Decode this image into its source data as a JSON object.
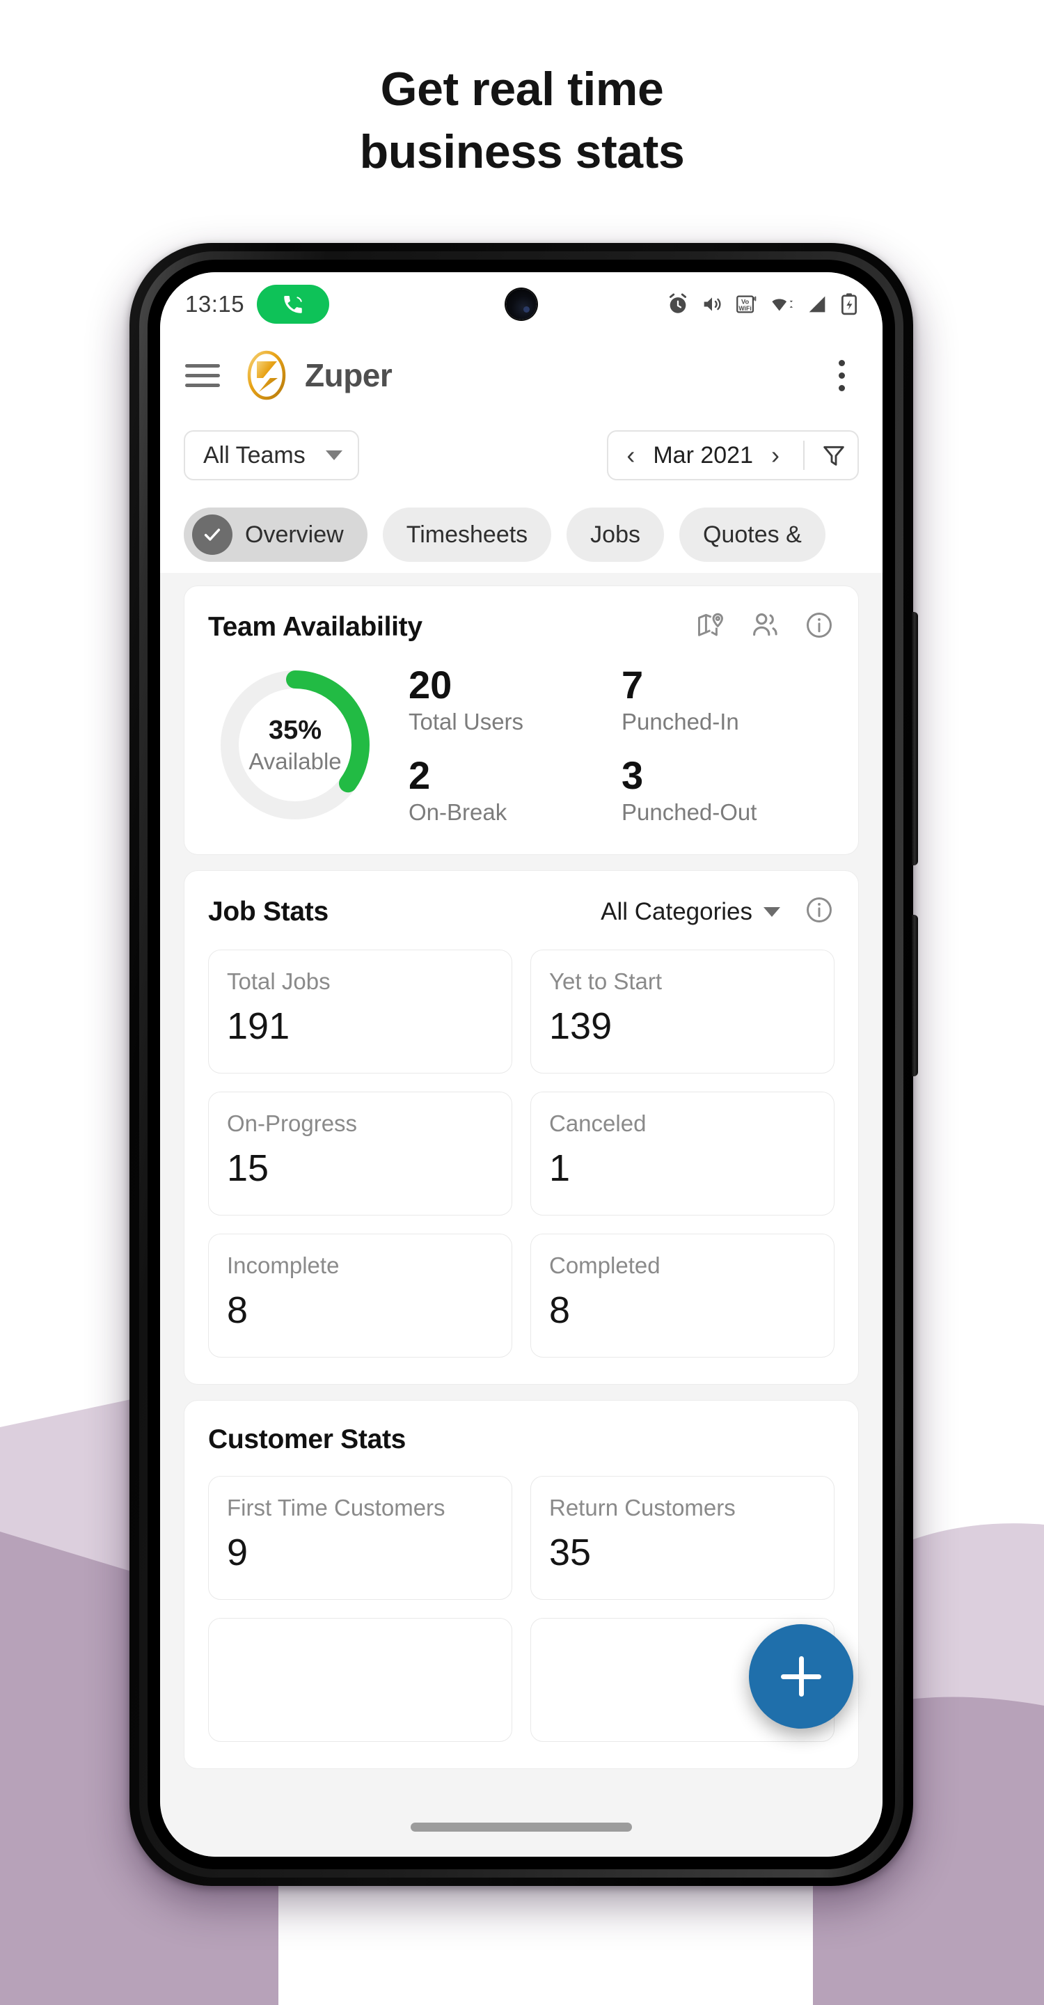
{
  "headline": {
    "line1": "Get real time",
    "line2": "business stats"
  },
  "statusbar": {
    "time": "13:15",
    "call_icon": "phone-call-icon",
    "icons": [
      "alarm-icon",
      "volume-icon",
      "vowifi-icon",
      "wifi-icon",
      "signal-icon",
      "battery-charging-icon"
    ]
  },
  "appbar": {
    "menu_icon": "hamburger-menu-icon",
    "logo_icon": "zuper-logo-icon",
    "title": "Zuper",
    "overflow_icon": "more-vertical-icon"
  },
  "filters": {
    "team_select": "All Teams",
    "prev_arrow": "‹",
    "period": "Mar 2021",
    "next_arrow": "›",
    "filter_icon": "funnel-filter-icon"
  },
  "tabs": [
    {
      "label": "Overview",
      "active": true
    },
    {
      "label": "Timesheets",
      "active": false
    },
    {
      "label": "Jobs",
      "active": false
    },
    {
      "label": "Quotes &",
      "active": false
    }
  ],
  "team_availability": {
    "title": "Team Availability",
    "icons": [
      "map-pin-icon",
      "people-icon",
      "info-icon"
    ],
    "donut": {
      "percent": "35%",
      "sub": "Available"
    },
    "stats": [
      {
        "value": "20",
        "label": "Total Users"
      },
      {
        "value": "7",
        "label": "Punched-In"
      },
      {
        "value": "2",
        "label": "On-Break"
      },
      {
        "value": "3",
        "label": "Punched-Out"
      }
    ]
  },
  "job_stats": {
    "title": "Job Stats",
    "category_select": "All Categories",
    "info_icon": "info-icon",
    "tiles": [
      {
        "label": "Total Jobs",
        "value": "191"
      },
      {
        "label": "Yet to Start",
        "value": "139"
      },
      {
        "label": "On-Progress",
        "value": "15"
      },
      {
        "label": "Canceled",
        "value": "1"
      },
      {
        "label": "Incomplete",
        "value": "8"
      },
      {
        "label": "Completed",
        "value": "8"
      }
    ]
  },
  "customer_stats": {
    "title": "Customer Stats",
    "tiles": [
      {
        "label": "First Time Customers",
        "value": "9"
      },
      {
        "label": "Return Customers",
        "value": "35"
      }
    ]
  },
  "fab": {
    "icon": "plus-icon"
  },
  "colors": {
    "accent_green": "#22bb44",
    "fab_blue": "#1f6fab",
    "brand_gold": "#e8a317",
    "call_green": "#0ec258",
    "bg_lavender_light": "#dccfdd",
    "bg_lavender_dark": "#b7a2b9",
    "track_grey": "#efefef"
  },
  "chart_data": {
    "type": "pie",
    "title": "Team Availability",
    "categories": [
      "Available",
      "Unavailable"
    ],
    "values": [
      35,
      65
    ],
    "unit": "%",
    "center_label": "35%",
    "center_sublabel": "Available",
    "colors": [
      "#22bb44",
      "#efefef"
    ],
    "legend": "none",
    "start_angle_deg": 0,
    "direction": "clockwise"
  }
}
